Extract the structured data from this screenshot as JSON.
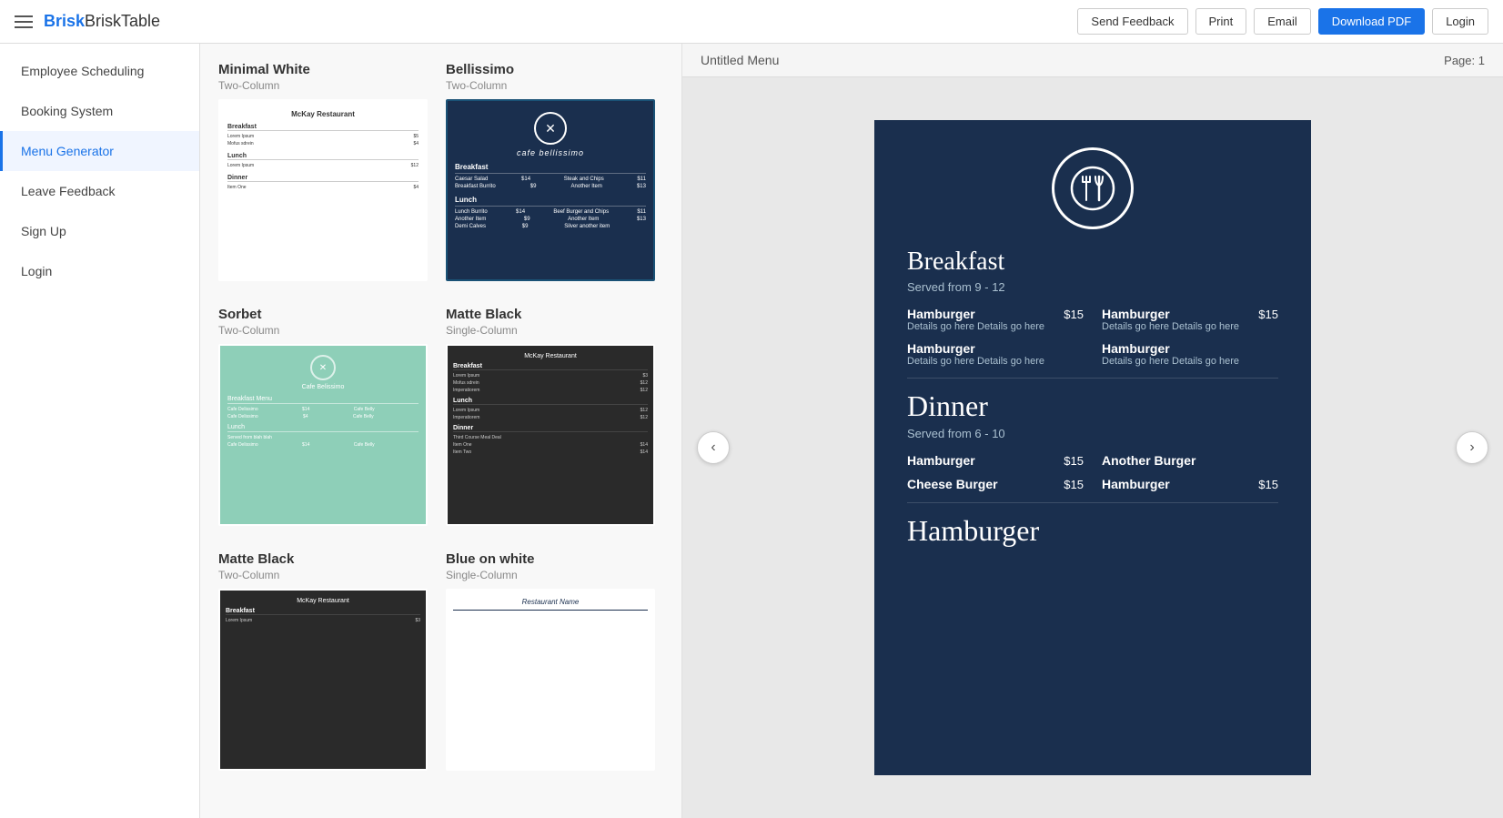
{
  "header": {
    "brand": "BriskTable",
    "brand_bold": "Brisk",
    "buttons": {
      "send_feedback": "Send Feedback",
      "print": "Print",
      "email": "Email",
      "download_pdf": "Download PDF",
      "login": "Login"
    }
  },
  "sidebar": {
    "items": [
      {
        "id": "employee-scheduling",
        "label": "Employee Scheduling",
        "active": false
      },
      {
        "id": "booking-system",
        "label": "Booking System",
        "active": false
      },
      {
        "id": "menu-generator",
        "label": "Menu Generator",
        "active": true
      },
      {
        "id": "leave-feedback",
        "label": "Leave Feedback",
        "active": false
      },
      {
        "id": "sign-up",
        "label": "Sign Up",
        "active": false
      },
      {
        "id": "login",
        "label": "Login",
        "active": false
      }
    ]
  },
  "templates": {
    "rows": [
      {
        "cards": [
          {
            "id": "minimal-white",
            "name": "Minimal White",
            "sub": "Two-Column",
            "style": "minimal",
            "selected": false
          },
          {
            "id": "bellissimo",
            "name": "Bellissimo",
            "sub": "Two-Column",
            "style": "bellissimo",
            "selected": true
          }
        ]
      },
      {
        "cards": [
          {
            "id": "sorbet",
            "name": "Sorbet",
            "sub": "Two-Column",
            "style": "sorbet",
            "selected": false
          },
          {
            "id": "matte-black",
            "name": "Matte Black",
            "sub": "Single-Column",
            "style": "matte",
            "selected": false
          }
        ]
      },
      {
        "cards": [
          {
            "id": "matte-black-2",
            "name": "Matte Black",
            "sub": "Two-Column",
            "style": "matte",
            "selected": false
          },
          {
            "id": "blue-on-white",
            "name": "Blue on white",
            "sub": "Single-Column",
            "style": "blue",
            "selected": false
          }
        ]
      }
    ]
  },
  "preview": {
    "menu_title": "Untitled Menu",
    "page_label": "Page:",
    "page_number": "1",
    "nav_prev": "‹",
    "nav_next": "›",
    "menu": {
      "logo_icon": "✕",
      "sections": [
        {
          "title": "Breakfast",
          "subtitle": "Served from 9 - 12",
          "items_rows": [
            [
              {
                "name": "Hamburger",
                "detail": "Details go here Details go here",
                "price": "$15"
              },
              {
                "name": "Hamburger",
                "detail": "Details go here Details go here",
                "price": "$15"
              }
            ],
            [
              {
                "name": "Hamburger",
                "detail": "Details go here Details go here",
                "price": ""
              },
              {
                "name": "Hamburger",
                "detail": "Details go here Details go here",
                "price": ""
              }
            ]
          ]
        },
        {
          "title": "Dinner",
          "subtitle": "Served from 6 - 10",
          "solo_items": [
            {
              "name": "Hamburger",
              "price": "$15",
              "col2_name": "Another Burger",
              "col2_price": ""
            },
            {
              "name": "Cheese Burger",
              "price": "$15",
              "col2_name": "Hamburger",
              "col2_price": "$15"
            }
          ]
        }
      ],
      "footer_item": "Hamburger"
    }
  },
  "colors": {
    "bellissimo_bg": "#1a2f4e",
    "sorbet_bg": "#8ecfb8",
    "matte_bg": "#2a2a2a",
    "accent_blue": "#1a73e8",
    "selected_border": "#1a5276"
  }
}
